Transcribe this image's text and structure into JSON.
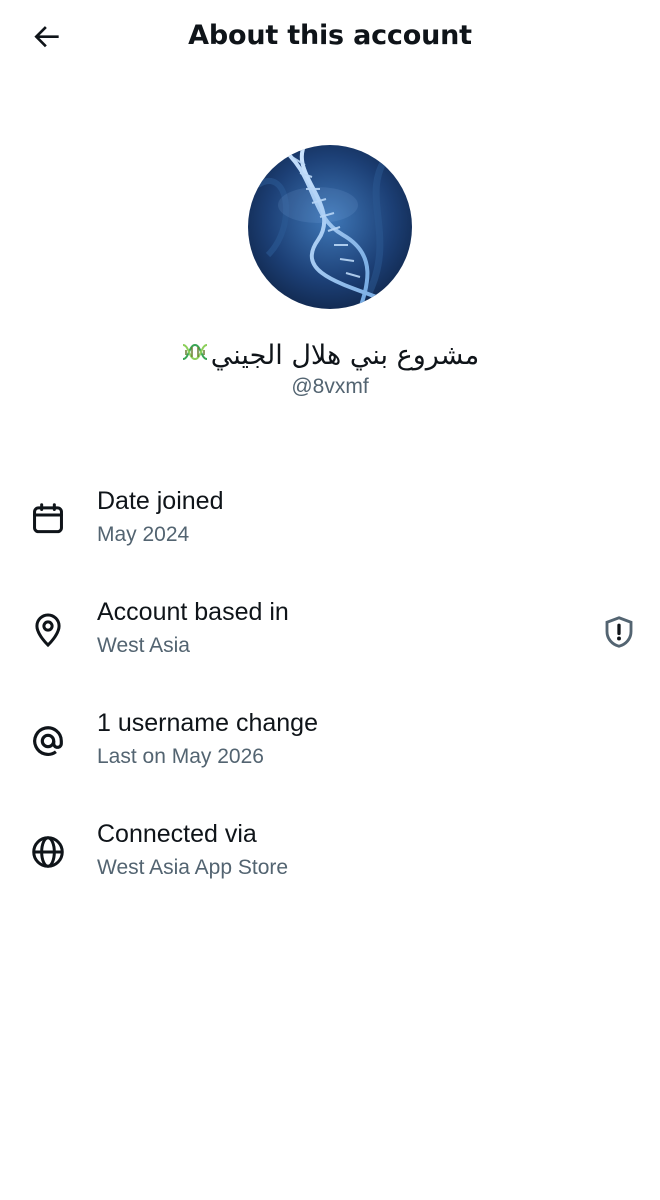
{
  "header": {
    "title": "About this account",
    "back_icon": "arrow-left-icon"
  },
  "profile": {
    "display_name": "مشروع بني هلال الجيني",
    "emoji": "dna-icon",
    "handle": "@8vxmf",
    "avatar": "dna-helix-blue-image"
  },
  "rows": [
    {
      "icon": "calendar-icon",
      "label": "Date joined",
      "value": "May 2024"
    },
    {
      "icon": "location-pin-icon",
      "label": "Account based in",
      "value": "West Asia",
      "badge_icon": "shield-alert-icon"
    },
    {
      "icon": "at-sign-icon",
      "label": "1 username change",
      "value": "Last on May 2026"
    },
    {
      "icon": "globe-icon",
      "label": "Connected via",
      "value": "West Asia App Store"
    }
  ],
  "colors": {
    "text": "#0f1419",
    "secondary_text": "#536471",
    "background": "#ffffff"
  }
}
